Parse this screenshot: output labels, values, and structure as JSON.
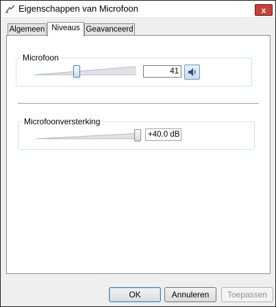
{
  "window": {
    "title": "Eigenschappen van Microfoon",
    "close_label": "x"
  },
  "tabs": [
    {
      "label": "Algemeen",
      "active": false
    },
    {
      "label": "Niveaus",
      "active": true
    },
    {
      "label": "Geavanceerd",
      "active": false
    }
  ],
  "microphone": {
    "label": "Microfoon",
    "level_value": "41",
    "level_fraction": 0.41,
    "mute_icon": "speaker-icon"
  },
  "boost": {
    "label": "Microfoonversterking",
    "value": "+40.0 dB",
    "level_fraction": 1.0
  },
  "buttons": {
    "ok": "OK",
    "cancel": "Annuleren",
    "apply": "Toepassen"
  },
  "colors": {
    "close": "#c8403a",
    "accent": "#3c7fb1"
  }
}
